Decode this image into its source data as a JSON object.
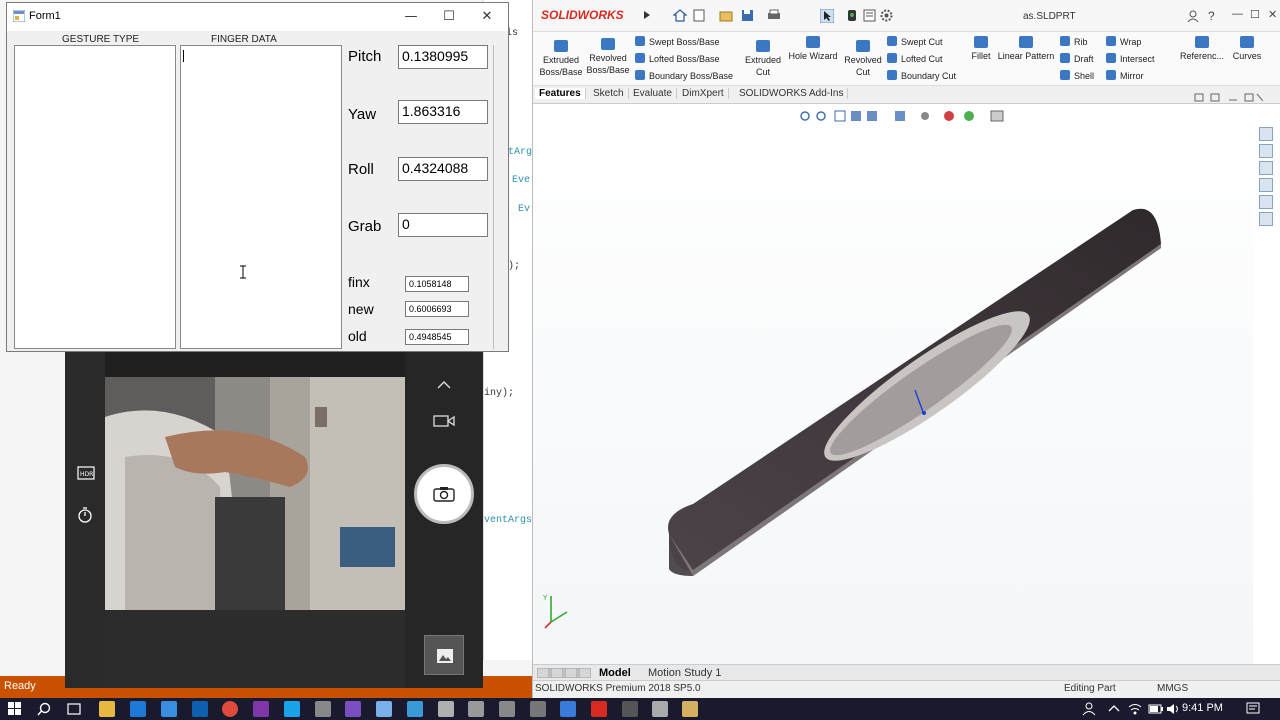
{
  "form1": {
    "title": "Form1",
    "window_buttons": {
      "minimize": "—",
      "maximize": "☐",
      "close": "✕"
    },
    "columns": {
      "gesture": "GESTURE TYPE",
      "finger": "FINGER DATA"
    },
    "fields": {
      "pitch": {
        "label": "Pitch",
        "value": "0.1380995"
      },
      "yaw": {
        "label": "Yaw",
        "value": "1.863316"
      },
      "roll": {
        "label": "Roll",
        "value": "0.4324088"
      },
      "grab": {
        "label": "Grab",
        "value": "0"
      },
      "finx": {
        "label": "finx",
        "value": "0.1058148"
      },
      "new": {
        "label": "new",
        "value": "0.6006693"
      },
      "old": {
        "label": "old",
        "value": "0.4948545"
      }
    }
  },
  "vs": {
    "status": "Ready",
    "code_fragments": [
      "ls",
      "tArgs",
      "Eve",
      ", Ev",
      ");",
      "iny);",
      "ventArgs"
    ]
  },
  "camera": {
    "icons": [
      "hdr-icon",
      "timer-icon",
      "chevron-up-icon",
      "video-icon",
      "camera-icon",
      "gallery-icon"
    ]
  },
  "solidworks": {
    "logo": "SOLIDWORKS",
    "file": "as.SLDPRT",
    "ribbon": {
      "extruded_boss": "Extruded Boss/Base",
      "revolved_boss": "Revolved Boss/Base",
      "swept_boss": "Swept Boss/Base",
      "lofted_boss": "Lofted Boss/Base",
      "boundary_boss": "Boundary Boss/Base",
      "extruded_cut": "Extruded Cut",
      "hole_wizard": "Hole Wizard",
      "revolved_cut": "Revolved Cut",
      "swept_cut": "Swept Cut",
      "lofted_cut": "Lofted Cut",
      "boundary_cut": "Boundary Cut",
      "fillet": "Fillet",
      "linear_pattern": "Linear Pattern",
      "rib": "Rib",
      "draft": "Draft",
      "shell": "Shell",
      "wrap": "Wrap",
      "intersect": "Intersect",
      "mirror": "Mirror",
      "reference": "Referenc...",
      "curves": "Curves"
    },
    "tabs": [
      "Features",
      "Sketch",
      "Evaluate",
      "DimXpert",
      "SOLIDWORKS Add-Ins"
    ],
    "bottom_tabs": {
      "model": "Model",
      "motion": "Motion Study 1"
    },
    "status": {
      "version": "SOLIDWORKS Premium 2018 SP5.0",
      "mode": "Editing Part",
      "units": "MMGS"
    }
  },
  "taskbar": {
    "time": "9:41 PM"
  },
  "colors": {
    "sw_brand": "#d82a20",
    "vs_status": "#ca5100",
    "taskbar": "#1a1a2e"
  }
}
